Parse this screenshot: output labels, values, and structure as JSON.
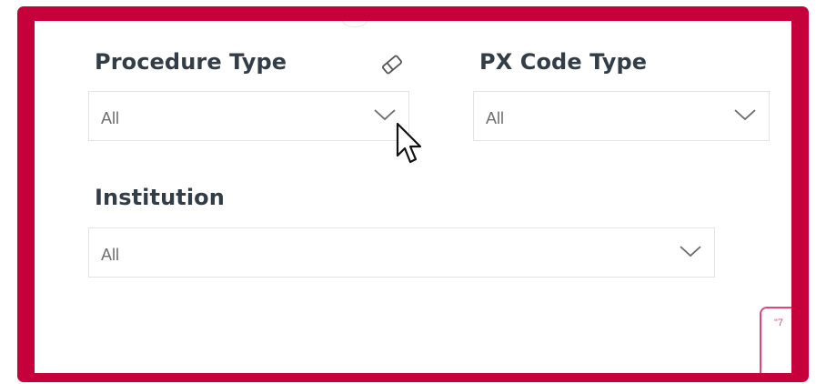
{
  "filters": {
    "procedure_type": {
      "label": "Procedure Type",
      "value": "All",
      "clear_icon": "eraser-icon",
      "dropdown_icon": "chevron-down-icon"
    },
    "px_code_type": {
      "label": "PX Code Type",
      "value": "All",
      "dropdown_icon": "chevron-down-icon"
    },
    "institution": {
      "label": "Institution",
      "value": "All",
      "dropdown_icon": "chevron-down-icon"
    }
  },
  "corner_card": {
    "text": "\"7"
  },
  "colors": {
    "frame": "#c5003a",
    "label": "#333d47",
    "value_text": "#6f6f6f",
    "border": "#e3e3e3",
    "card_border": "#e0457a"
  },
  "pointer": "arrow-cursor-icon"
}
